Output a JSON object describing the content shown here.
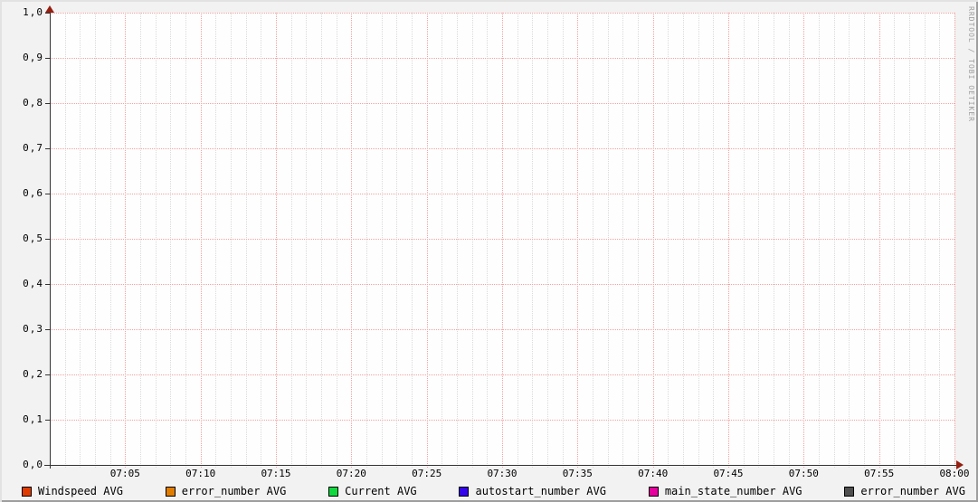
{
  "watermark": "RRDTOOL / TOBI OETIKER",
  "colors": {
    "background": "#F2F2F2",
    "plot_background": "#FEFEFE",
    "axis": "#333333",
    "arrow": "#951F12",
    "major_grid": "#F2A2A2",
    "minor_grid": "#DADADA",
    "watermark_text": "#9E9E9E"
  },
  "chart_data": {
    "type": "line",
    "title": "",
    "xlabel": "",
    "ylabel": "",
    "x_range": [
      "07:00",
      "08:00"
    ],
    "x_ticks": [
      "07:05",
      "07:10",
      "07:15",
      "07:20",
      "07:25",
      "07:30",
      "07:35",
      "07:40",
      "07:45",
      "07:50",
      "07:55",
      "08:00"
    ],
    "x_minor_step_minutes": 1,
    "x_major_step_minutes": 5,
    "y_ticks": [
      "1,0",
      "0,9",
      "0,8",
      "0,7",
      "0,6",
      "0,5",
      "0,4",
      "0,3",
      "0,2",
      "0,1",
      "0,0"
    ],
    "ylim": [
      0.0,
      1.0
    ],
    "grid": true,
    "legend_position": "bottom",
    "series": [
      {
        "name": "Windspeed AVG",
        "color": "#DF3B00",
        "values": []
      },
      {
        "name": "error_number AVG",
        "color": "#E07D00",
        "values": []
      },
      {
        "name": "Current AVG",
        "color": "#10D940",
        "values": []
      },
      {
        "name": "autostart_number AVG",
        "color": "#3305EB",
        "values": []
      },
      {
        "name": "main_state_number AVG",
        "color": "#E6009D",
        "values": []
      },
      {
        "name": "error_number AVG",
        "color": "#4F4F4F",
        "values": []
      }
    ]
  }
}
